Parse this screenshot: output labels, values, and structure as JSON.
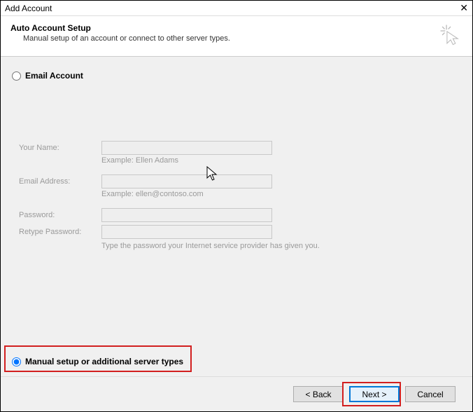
{
  "window": {
    "title": "Add Account"
  },
  "header": {
    "title": "Auto Account Setup",
    "subtitle": "Manual setup of an account or connect to other server types."
  },
  "options": {
    "email_account": "Email Account",
    "manual_setup": "Manual setup or additional server types"
  },
  "form": {
    "name_label": "Your Name:",
    "name_hint": "Example: Ellen Adams",
    "email_label": "Email Address:",
    "email_hint": "Example: ellen@contoso.com",
    "password_label": "Password:",
    "retype_label": "Retype Password:",
    "password_hint": "Type the password your Internet service provider has given you."
  },
  "buttons": {
    "back": "< Back",
    "next": "Next >",
    "cancel": "Cancel"
  }
}
